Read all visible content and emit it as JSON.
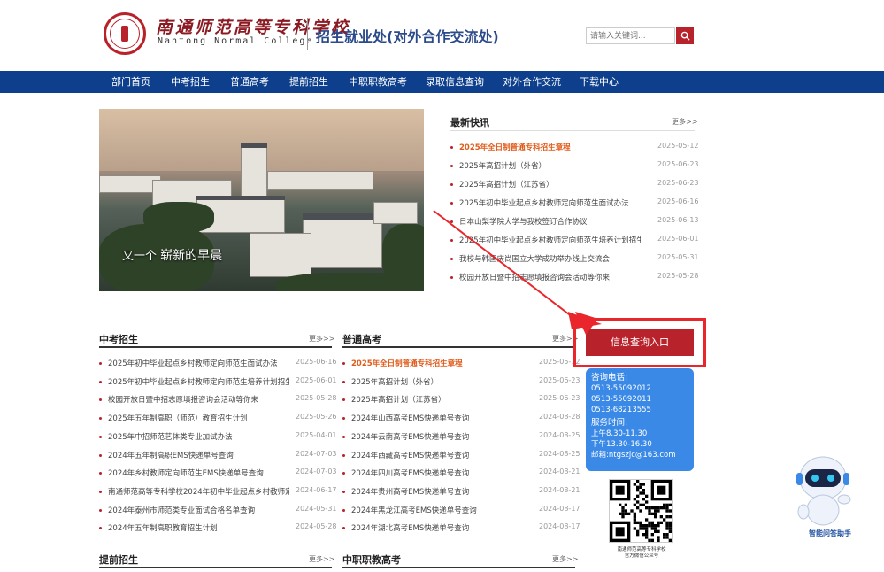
{
  "header": {
    "school_cn": "南通师范高等专科学校",
    "school_en": "Nantong Normal College",
    "dept": "招生就业处(对外合作交流处)",
    "search_placeholder": "请输入关键词...",
    "accent": "#b8232b"
  },
  "nav": {
    "items": [
      "部门首页",
      "中考招生",
      "普通高考",
      "提前招生",
      "中职职教高考",
      "录取信息查询",
      "对外合作交流",
      "下载中心"
    ]
  },
  "hero": {
    "caption_a": "又一个",
    "caption_b": "崭新的早晨"
  },
  "latest": {
    "title": "最新快讯",
    "more": "更多>>",
    "items": [
      {
        "text": "2025年全日制普通专科招生章程",
        "date": "2025-05-12"
      },
      {
        "text": "2025年高招计划（外省）",
        "date": "2025-06-23"
      },
      {
        "text": "2025年高招计划（江苏省）",
        "date": "2025-06-23"
      },
      {
        "text": "2025年初中毕业起点乡村教师定向师范生面试办法",
        "date": "2025-06-16"
      },
      {
        "text": "日本山梨学院大学与我校签订合作协议",
        "date": "2025-06-13"
      },
      {
        "text": "2025年初中毕业起点乡村教师定向师范生培养计划招生简章",
        "date": "2025-06-01"
      },
      {
        "text": "我校与韩国庆尚国立大学成功举办线上交流会",
        "date": "2025-05-31"
      },
      {
        "text": "校园开放日暨中招志愿填报咨询会活动等你来",
        "date": "2025-05-28"
      }
    ]
  },
  "zhongkao": {
    "title": "中考招生",
    "more": "更多>>",
    "items": [
      {
        "text": "2025年初中毕业起点乡村教师定向师范生面试办法",
        "date": "2025-06-16"
      },
      {
        "text": "2025年初中毕业起点乡村教师定向师范生培养计划招生...",
        "date": "2025-06-01"
      },
      {
        "text": "校园开放日暨中招志愿填报咨询会活动等你来",
        "date": "2025-05-28"
      },
      {
        "text": "2025年五年制高职（师范）教育招生计划",
        "date": "2025-05-26"
      },
      {
        "text": "2025年中招师范艺体类专业加试办法",
        "date": "2025-04-01"
      },
      {
        "text": "2024年五年制高职EMS快递单号查询",
        "date": "2024-07-03"
      },
      {
        "text": "2024年乡村教师定向师范生EMS快递单号查询",
        "date": "2024-07-03"
      },
      {
        "text": "南通师范高等专科学校2024年初中毕业起点乡村教师定...",
        "date": "2024-06-17"
      },
      {
        "text": "2024年泰州市师范类专业面试合格名单查询",
        "date": "2024-05-31"
      },
      {
        "text": "2024年五年制高职教育招生计划",
        "date": "2024-05-28"
      }
    ]
  },
  "gaokao": {
    "title": "普通高考",
    "more": "更多>>",
    "items": [
      {
        "text": "2025年全日制普通专科招生章程",
        "date": "2025-05-12"
      },
      {
        "text": "2025年高招计划（外省）",
        "date": "2025-06-23"
      },
      {
        "text": "2025年高招计划（江苏省）",
        "date": "2025-06-23"
      },
      {
        "text": "2024年山西高考EMS快递单号查询",
        "date": "2024-08-28"
      },
      {
        "text": "2024年云南高考EMS快递单号查询",
        "date": "2024-08-25"
      },
      {
        "text": "2024年西藏高考EMS快递单号查询",
        "date": "2024-08-25"
      },
      {
        "text": "2024年四川高考EMS快递单号查询",
        "date": "2024-08-21"
      },
      {
        "text": "2024年贵州高考EMS快递单号查询",
        "date": "2024-08-21"
      },
      {
        "text": "2024年黑龙江高考EMS快递单号查询",
        "date": "2024-08-17"
      },
      {
        "text": "2024年湖北高考EMS快递单号查询",
        "date": "2024-08-17"
      }
    ]
  },
  "tiqian": {
    "title": "提前招生",
    "more": "更多>>"
  },
  "zhongzhi": {
    "title": "中职职教高考",
    "more": "更多>>"
  },
  "cta": {
    "label": "信息查询入口"
  },
  "contact": {
    "phone_title": "咨询电话:",
    "phones": [
      "0513-55092012",
      "0513-55092011",
      "0513-68213555"
    ],
    "hours_title": "服务时间:",
    "am": "上午8.30-11.30",
    "pm": "下午13.30-16.30",
    "email": "邮箱:ntgszjc@163.com"
  },
  "qr": {
    "caption_1": "南通师范高等专科学校",
    "caption_2": "官方微信公众号"
  },
  "assistant": {
    "label": "智能问答助手"
  }
}
